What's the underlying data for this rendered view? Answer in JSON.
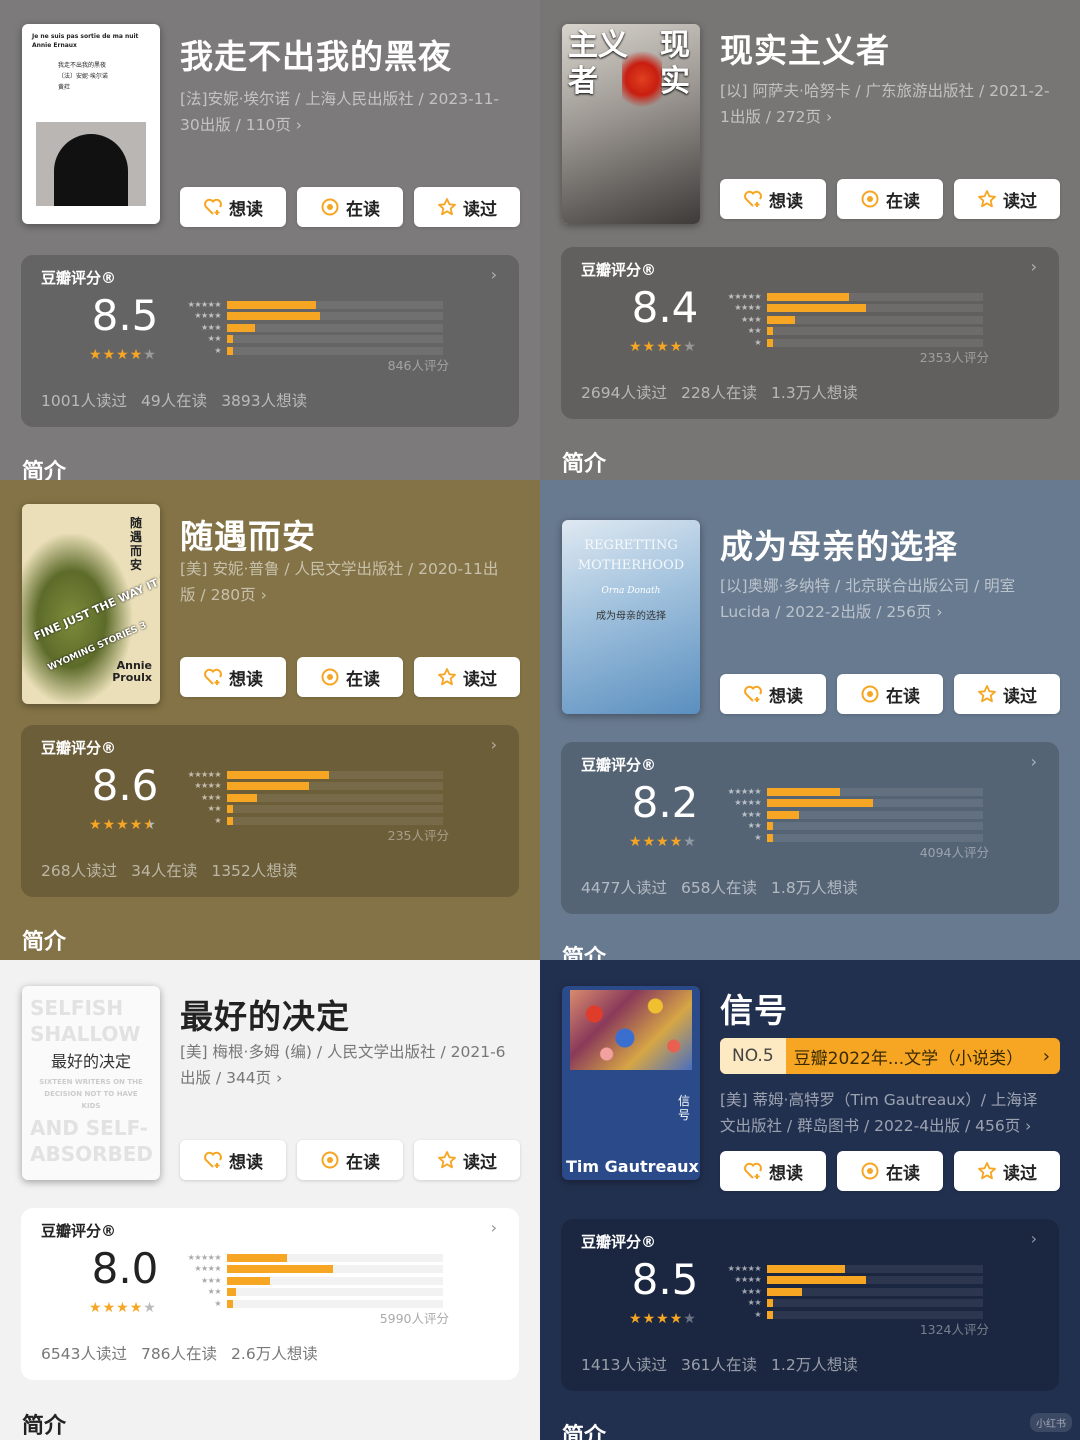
{
  "ui": {
    "want_label": "想读",
    "reading_label": "在读",
    "read_label": "读过",
    "rating_label": "豆瓣评分®",
    "section_title": "简介",
    "star_levels": [
      "★★★★★",
      "★★★★",
      "★★★",
      "★★",
      "★"
    ]
  },
  "books": [
    {
      "title": "我走不出我的黑夜",
      "meta": "[法]安妮·埃尔诺 / 上海人民出版社 / 2023-11-30出版 / 110页 ›",
      "cover": {
        "line1": "Je ne suis pas sortie de ma nuit",
        "line2": "Annie Ernaux",
        "line3": "我走不出我的黑夜",
        "line4": "〔法〕安妮·埃尔诺",
        "line5": "黄荭"
      },
      "rating": {
        "score": "8.5",
        "stars": 4,
        "dist": [
          0.41,
          0.43,
          0.13,
          0.03,
          0.02
        ],
        "count": "846人评分",
        "read": "1001人读过",
        "reading": "49人在读",
        "want": "3893人想读"
      }
    },
    {
      "title": "现实主义者",
      "meta": "[以] 阿萨夫·哈努卡 / 广东旅游出版社 / 2021-2-1出版 / 272页 ›",
      "cover": {
        "line1": "现实",
        "line2": "主义者"
      },
      "rating": {
        "score": "8.4",
        "stars": 4,
        "dist": [
          0.38,
          0.46,
          0.13,
          0.02,
          0.01
        ],
        "count": "2353人评分",
        "read": "2694人读过",
        "reading": "228人在读",
        "want": "1.3万人想读"
      }
    },
    {
      "title": "随遇而安",
      "meta": "[美] 安妮·普鲁 / 人民文学出版社 / 2020-11出版 / 280页 ›",
      "cover": {
        "line1": "随遇而安",
        "line2": "FINE JUST THE WAY IT IS",
        "line3": "WYOMING STORIES 3",
        "line4": "Annie Proulx"
      },
      "rating": {
        "score": "8.6",
        "stars": 4.5,
        "dist": [
          0.47,
          0.38,
          0.14,
          0.01,
          0.01
        ],
        "count": "235人评分",
        "read": "268人读过",
        "reading": "34人在读",
        "want": "1352人想读"
      }
    },
    {
      "title": "成为母亲的选择",
      "meta": "[以]奥娜·多纳特 / 北京联合出版公司 / 明室Lucida / 2022-2出版 / 256页 ›",
      "cover": {
        "line1": "REGRETTING MOTHERHOOD",
        "line2": "Orna Donath",
        "line3": "成为母亲的选择"
      },
      "rating": {
        "score": "8.2",
        "stars": 4,
        "dist": [
          0.34,
          0.49,
          0.15,
          0.02,
          0.01
        ],
        "count": "4094人评分",
        "read": "4477人读过",
        "reading": "658人在读",
        "want": "1.8万人想读"
      }
    },
    {
      "title": "最好的决定",
      "meta": "[美] 梅根·多姆 (编) / 人民文学出版社 / 2021-6出版 / 344页 ›",
      "cover": {
        "line1": "SELFISH",
        "line2": "SHALLOW",
        "line3": "最好的决定",
        "line4": "SIXTEEN WRITERS ON THE DECISION NOT TO HAVE KIDS",
        "line5": "AND SELF-",
        "line6": "ABSORBED"
      },
      "rating": {
        "score": "8.0",
        "stars": 4,
        "dist": [
          0.28,
          0.49,
          0.2,
          0.04,
          0.01
        ],
        "count": "5990人评分",
        "read": "6543人读过",
        "reading": "786人在读",
        "want": "2.6万人想读"
      }
    },
    {
      "title": "信号",
      "meta": "[美] 蒂姆·高特罗（Tim Gautreaux）/ 上海译文出版社 / 群岛图书 / 2022-4出版 / 456页 ›",
      "tag": {
        "no": "NO.5",
        "text": "豆瓣2022年...文学（小说类）"
      },
      "cover": {
        "line1": "信号",
        "line2": "Tim Gautreaux"
      },
      "rating": {
        "score": "8.5",
        "stars": 4,
        "dist": [
          0.36,
          0.46,
          0.16,
          0.02,
          0.01
        ],
        "count": "1324人评分",
        "read": "1413人读过",
        "reading": "361人在读",
        "want": "1.2万人想读"
      }
    }
  ],
  "watermark": "小红书"
}
